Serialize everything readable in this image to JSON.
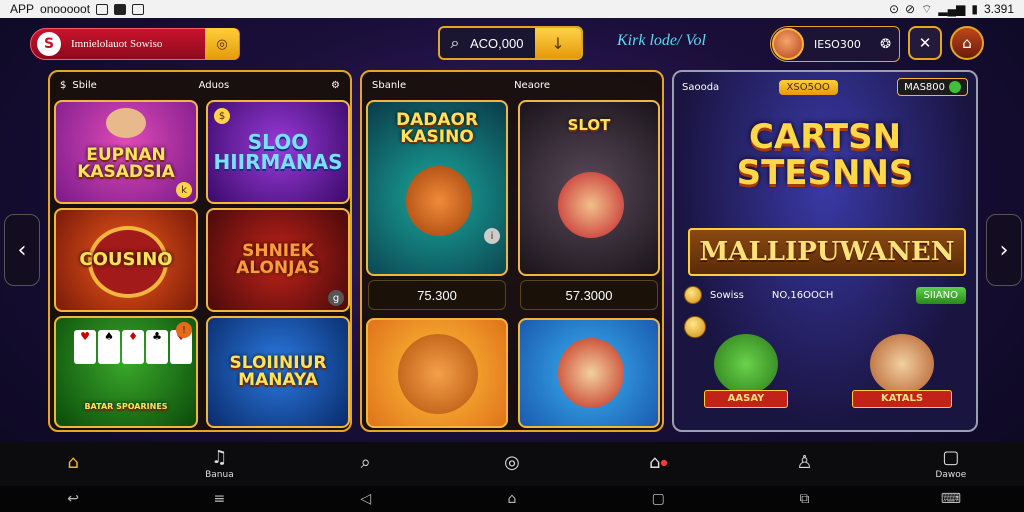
{
  "status_bar": {
    "app_label": "APP",
    "carrier": "onooooot",
    "time": "3.391"
  },
  "header": {
    "brand_text": "Imnielolauot Sowiso",
    "search_value": "ACO,000",
    "tagline": "Kirk lode/ Vol",
    "user_value": "IESO300"
  },
  "left_panel": {
    "head_left": "Sbile",
    "head_mid": "Aduos",
    "tiles": [
      {
        "title": "EUPNAN KASADSIA"
      },
      {
        "title": "SLOO HIIRMANAS"
      },
      {
        "title": "COUSINO"
      },
      {
        "title": "SHNIEK ALONJAS"
      },
      {
        "title": "BATAR SPOARINES"
      },
      {
        "title": "SLOIINIUR MANAYA"
      }
    ]
  },
  "mid_panel": {
    "head_left": "Sbanle",
    "head_mid": "Neaore",
    "tiles": [
      {
        "title": "DADAOR KASINO",
        "price": "75.300"
      },
      {
        "title": "SLOT",
        "price": "57.3000"
      },
      {
        "title": ""
      },
      {
        "title": ""
      }
    ]
  },
  "feature_panel": {
    "head_left": "Saooda",
    "badge": "XSO5OO",
    "badge2": "MAS800",
    "title": "CARTSN STESNNS",
    "banner": "MALLIPUWANEN",
    "row_left": "Sowiss",
    "row_mid": "NO,16OOCH",
    "row_btn": "SIIANO",
    "char_labels": [
      "AASAY",
      "KATALS"
    ]
  },
  "bottom_nav": [
    {
      "icon": "home-icon",
      "label": ""
    },
    {
      "icon": "bell-icon",
      "label": "Banua"
    },
    {
      "icon": "search-icon",
      "label": ""
    },
    {
      "icon": "target-icon",
      "label": ""
    },
    {
      "icon": "house-alert-icon",
      "label": ""
    },
    {
      "icon": "person-icon",
      "label": ""
    },
    {
      "icon": "tablet-icon",
      "label": "Dawoe"
    }
  ],
  "colors": {
    "accent": "#e5a722",
    "brand_red": "#c9132c",
    "nav_active": "#ffb21e"
  }
}
